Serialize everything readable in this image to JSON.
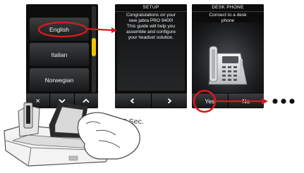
{
  "screen1": {
    "languages": [
      "English",
      "Italian",
      "Norwegian"
    ],
    "softkeys": {
      "close_icon": "×",
      "down_icon": "chevron-down",
      "up_icon": "chevron-up"
    }
  },
  "screen2": {
    "title": "SETUP",
    "message_lines": [
      "Congratulations on your",
      "new jabra PRO 9400!",
      "This guide will help you",
      "assemble and configure",
      "your headset solution."
    ],
    "softkeys": {
      "back_icon": "chevron-left",
      "next_icon": "chevron-right"
    }
  },
  "screen3": {
    "title": "DESK PHONE",
    "message_lines": [
      "Connect to a desk",
      "phone"
    ],
    "softkeys": {
      "yes": "Yes",
      "no": "No"
    }
  },
  "annotation": {
    "hold_time": "3 Sec."
  },
  "colors": {
    "highlight": "#d8191e",
    "scroll_accent": "#f0c400",
    "screen_bg": "#0c0c0c"
  }
}
